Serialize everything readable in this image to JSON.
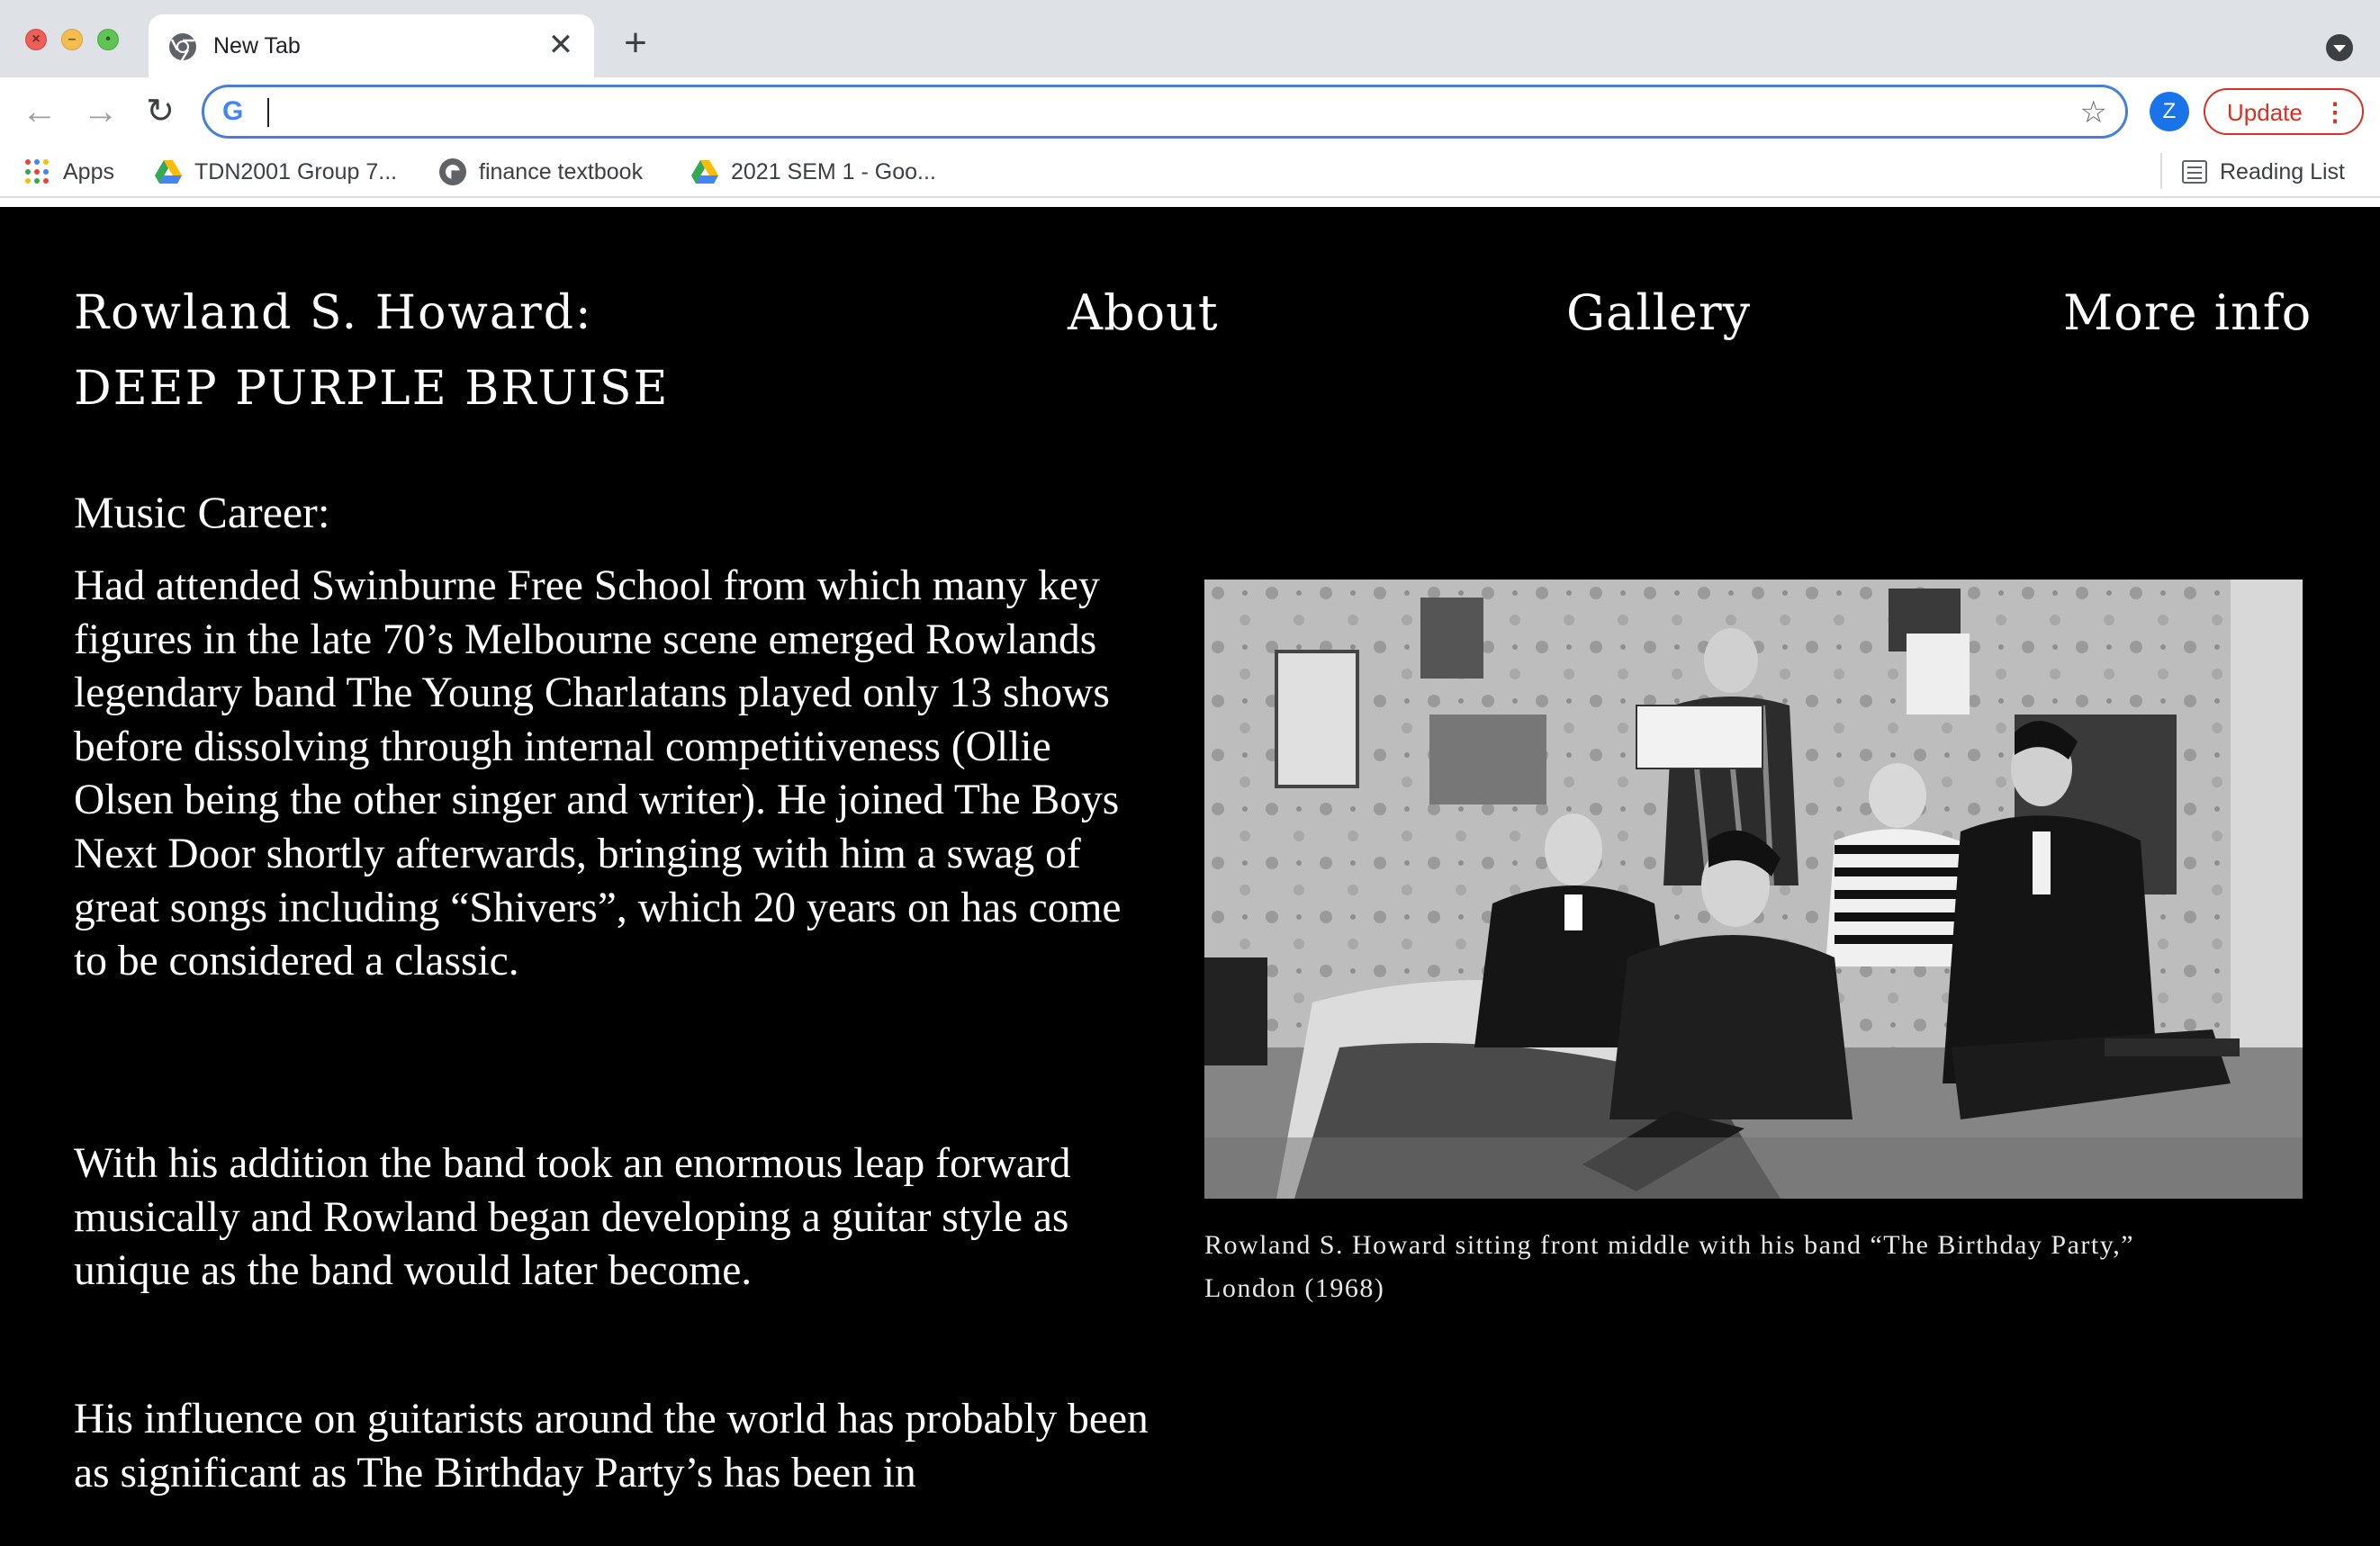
{
  "browser": {
    "tab_title": "New Tab",
    "tab_close": "✕",
    "new_tab": "+",
    "address_value": "",
    "profile_initial": "Z",
    "update_label": "Update",
    "update_menu": "⋮",
    "bookmarks": [
      {
        "label": "Apps",
        "icon": "apps-grid-icon"
      },
      {
        "label": "TDN2001 Group 7...",
        "icon": "google-drive-icon"
      },
      {
        "label": "finance textbook",
        "icon": "globe-icon"
      },
      {
        "label": "2021 SEM 1 - Goo...",
        "icon": "google-drive-icon"
      }
    ],
    "reading_list": "Reading List"
  },
  "site": {
    "title_line1": "Rowland S. Howard:",
    "title_line2": "DEEP PURPLE BRUISE",
    "nav": {
      "about": "About",
      "gallery": "Gallery",
      "more_info": "More info"
    }
  },
  "content": {
    "heading": "Music Career:",
    "paragraph1": "Had attended Swinburne Free School from which many key figures in the late 70’s Melbourne scene emerged Rowlands legendary band The Young Charlatans played only 13 shows before dissolving through internal competitiveness (Ollie Olsen being the other singer and writer). He joined The Boys Next Door shortly afterwards, bringing with him a swag of great songs including “Shivers”, which 20 years on has come to be considered a classic.",
    "paragraph2": "With his addition the band took an enormous leap forward musically and Rowland began developing a guitar style as unique as the band would later become.",
    "paragraph3": "His influence on guitarists around the world has probably been as significant as The Birthday Party’s has been in",
    "photo_caption": "Rowland S. Howard sitting front middle with his band “The Birthday Party,” London (1968)"
  },
  "colors": {
    "page_bg": "#000000",
    "text": "#ffffff",
    "omnibox_focus": "#4a7fd8",
    "update_red": "#d93025",
    "profile_blue": "#1a73e8"
  }
}
